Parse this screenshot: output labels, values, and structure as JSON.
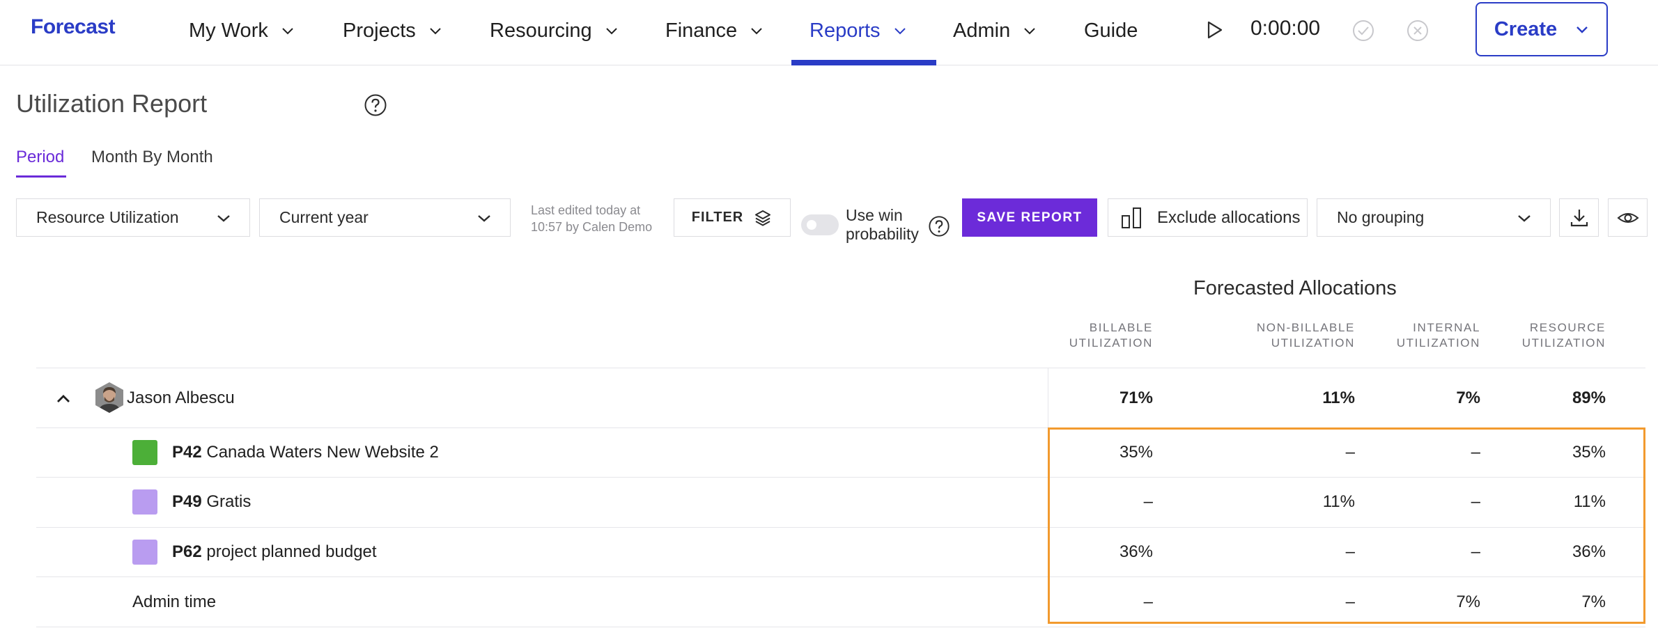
{
  "app": {
    "logo": "Forecast"
  },
  "nav": {
    "items": [
      {
        "label": "My Work"
      },
      {
        "label": "Projects"
      },
      {
        "label": "Resourcing"
      },
      {
        "label": "Finance"
      },
      {
        "label": "Reports"
      },
      {
        "label": "Admin"
      },
      {
        "label": "Guide"
      }
    ],
    "active": "Reports",
    "timer": "0:00:00",
    "create_label": "Create"
  },
  "page": {
    "title": "Utilization Report",
    "tabs": [
      {
        "label": "Period",
        "active": true
      },
      {
        "label": "Month By Month",
        "active": false
      }
    ]
  },
  "toolbar": {
    "report_type": "Resource Utilization",
    "period": "Current year",
    "last_edited_line1": "Last edited today at",
    "last_edited_line2": "10:57 by Calen Demo",
    "filter_label": "FILTER",
    "win_probability_line1": "Use win",
    "win_probability_line2": "probability",
    "win_probability_enabled": false,
    "save_label": "SAVE REPORT",
    "exclude_label": "Exclude allocations",
    "grouping": "No grouping"
  },
  "table": {
    "group_title": "Forecasted Allocations",
    "columns": [
      {
        "line1": "BILLABLE",
        "line2": "UTILIZATION"
      },
      {
        "line1": "NON-BILLABLE",
        "line2": "UTILIZATION"
      },
      {
        "line1": "INTERNAL",
        "line2": "UTILIZATION"
      },
      {
        "line1": "RESOURCE",
        "line2": "UTILIZATION"
      }
    ],
    "person": {
      "name": "Jason Albescu",
      "values": [
        "71%",
        "11%",
        "7%",
        "89%"
      ]
    },
    "rows": [
      {
        "code": "P42",
        "name": "Canada Waters New Website 2",
        "color": "#4caf38",
        "values": [
          "35%",
          "–",
          "–",
          "35%"
        ]
      },
      {
        "code": "P49",
        "name": "Gratis",
        "color": "#b99cf0",
        "values": [
          "–",
          "11%",
          "–",
          "11%"
        ]
      },
      {
        "code": "P62",
        "name": "project planned budget",
        "color": "#b99cf0",
        "values": [
          "36%",
          "–",
          "–",
          "36%"
        ]
      },
      {
        "code": "",
        "name": "Admin time",
        "color": "",
        "values": [
          "–",
          "–",
          "7%",
          "7%"
        ]
      }
    ],
    "highlight_color": "#f29a2e"
  }
}
